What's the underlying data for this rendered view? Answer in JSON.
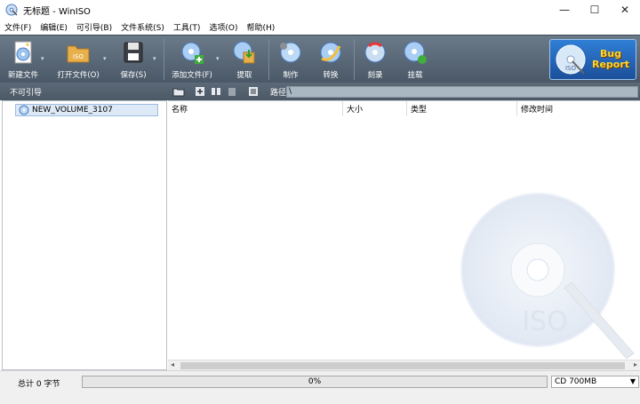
{
  "window": {
    "title": "无标题 - WinISO",
    "controls": {
      "minimize": "—",
      "maximize": "☐",
      "close": "✕"
    }
  },
  "menu": [
    "文件(F)",
    "编辑(E)",
    "可引导(B)",
    "文件系统(S)",
    "工具(T)",
    "选项(O)",
    "帮助(H)"
  ],
  "toolbar": {
    "new_file": "新建文件",
    "open_file": "打开文件(O)",
    "save": "保存(S)",
    "add_file": "添加文件(F)",
    "extract": "提取",
    "make": "制作",
    "convert": "转换",
    "burn": "刻录",
    "mount": "挂载",
    "bug_report_line1": "Bug",
    "bug_report_line2": "Report"
  },
  "left_panel": {
    "header": "不可引导",
    "tree_root": "NEW_VOLUME_3107"
  },
  "right_panel": {
    "path_label": "路径:",
    "path_value": "\\",
    "columns": [
      "名称",
      "大小",
      "类型",
      "修改时间"
    ]
  },
  "watermark_text": "ISO",
  "status": {
    "total": "总计 0 字节",
    "progress_text": "0%",
    "progress_value": 0,
    "disc_type": "CD 700MB"
  },
  "colors": {
    "toolbar_bg": "#4f5d6b",
    "bug_report_bg": "#2f7fd6",
    "bug_report_text": "#ffd82a"
  }
}
